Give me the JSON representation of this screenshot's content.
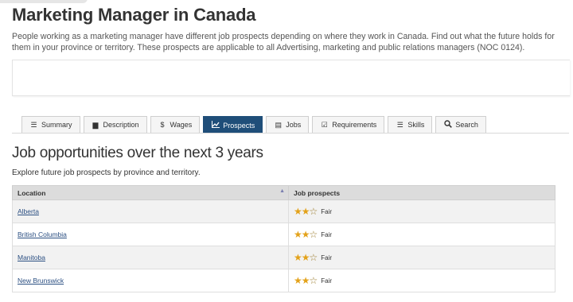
{
  "page": {
    "title": "Marketing Manager in Canada",
    "intro": "People working as a marketing manager have different job prospects depending on where they work in Canada. Find out what the future holds for them in your province or territory. These prospects are applicable to all Advertising, marketing and public relations managers (NOC 0124)."
  },
  "tabs": [
    {
      "label": "Summary",
      "icon": "list-icon"
    },
    {
      "label": "Description",
      "icon": "book-icon"
    },
    {
      "label": "Wages",
      "icon": "dollar-icon"
    },
    {
      "label": "Prospects",
      "icon": "chart-line-icon",
      "active": true
    },
    {
      "label": "Jobs",
      "icon": "newspaper-icon"
    },
    {
      "label": "Requirements",
      "icon": "checkbox-icon"
    },
    {
      "label": "Skills",
      "icon": "tasks-icon"
    },
    {
      "label": "Search",
      "icon": "search-icon"
    }
  ],
  "section": {
    "title": "Job opportunities over the next 3 years",
    "description": "Explore future job prospects by province and territory."
  },
  "table": {
    "headers": {
      "location": "Location",
      "prospects": "Job prospects"
    },
    "rows": [
      {
        "location": "Alberta",
        "rating": "Fair",
        "stars": 2,
        "max_stars": 3
      },
      {
        "location": "British Columbia",
        "rating": "Fair",
        "stars": 2,
        "max_stars": 3
      },
      {
        "location": "Manitoba",
        "rating": "Fair",
        "stars": 2,
        "max_stars": 3
      },
      {
        "location": "New Brunswick",
        "rating": "Fair",
        "stars": 2,
        "max_stars": 3
      }
    ]
  },
  "colors": {
    "active_tab": "#1f4e79",
    "star": "#e3a21a",
    "link": "#2b4f82"
  }
}
